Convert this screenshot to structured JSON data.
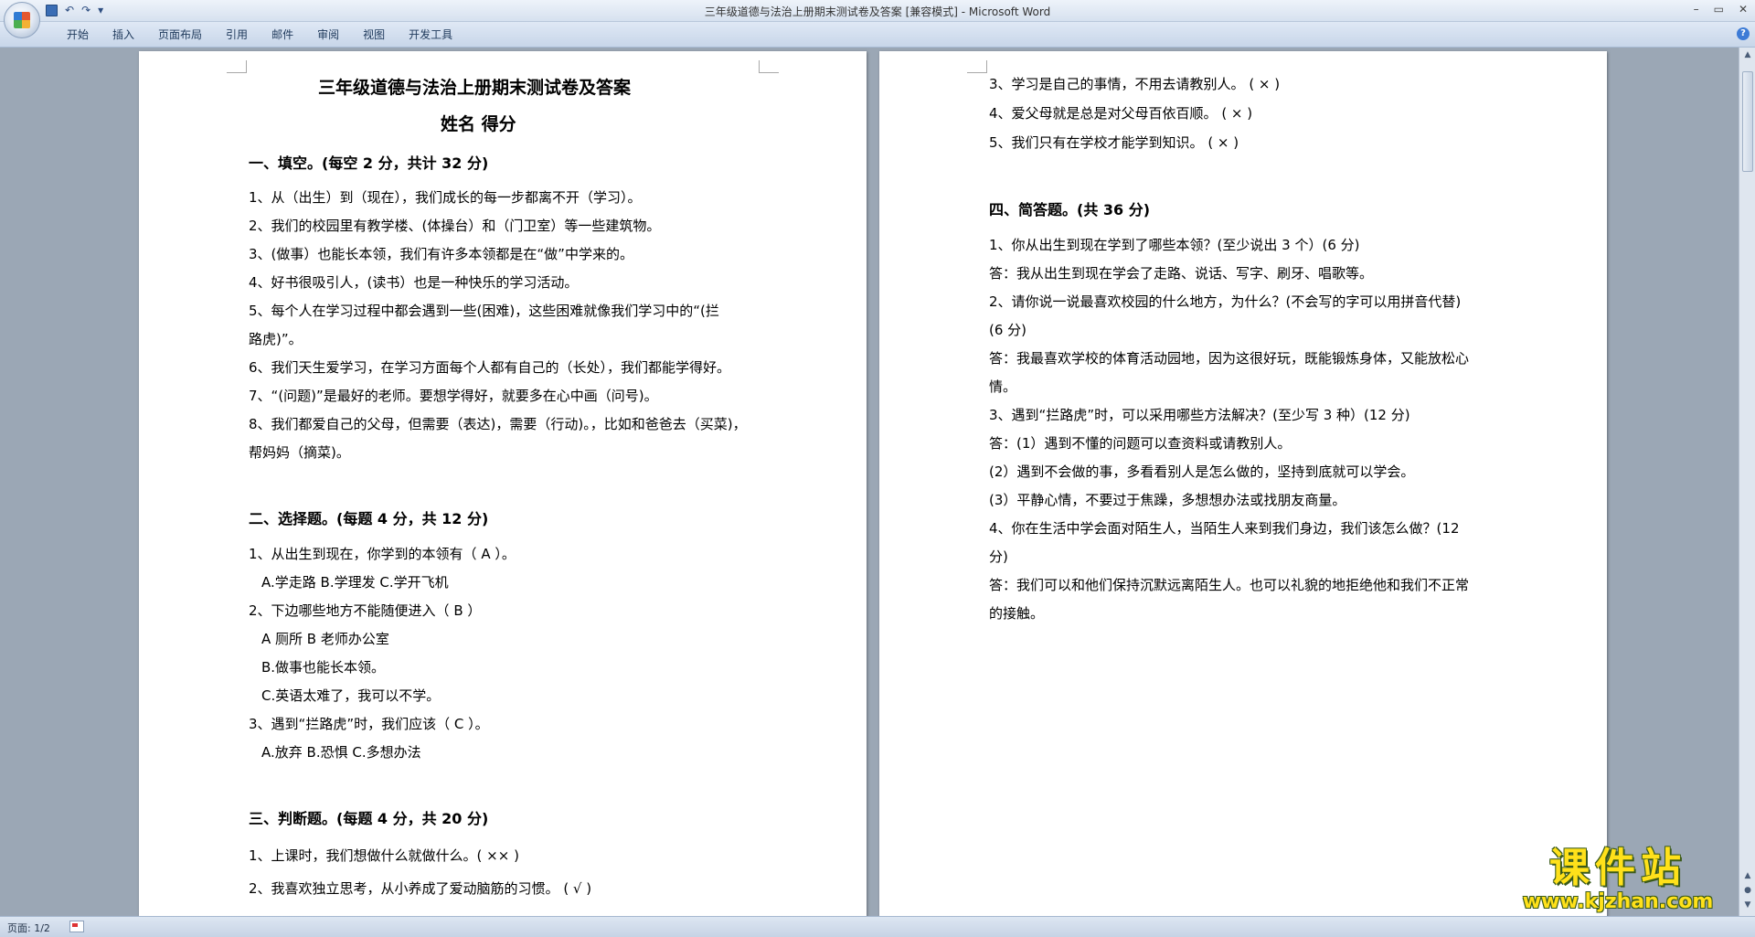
{
  "window": {
    "title": "三年级道德与法治上册期末测试卷及答案 [兼容模式] - Microsoft Word"
  },
  "qat": {
    "undo": "↶",
    "redo": "↷",
    "more": "▾"
  },
  "ribbon": {
    "tabs": [
      "开始",
      "插入",
      "页面布局",
      "引用",
      "邮件",
      "审阅",
      "视图",
      "开发工具"
    ],
    "help": "?"
  },
  "status": {
    "page": "页面: 1/2"
  },
  "watermark": {
    "line1": "课件站",
    "line2": "www.kjzhan.com"
  },
  "doc": {
    "page1": {
      "title": "三年级道德与法治上册期末测试卷及答案",
      "subtitle": "姓名        得分",
      "lines": [
        "一、填空。(每空 2 分，共计 32 分)",
        "1、从（出生）到（现在），我们成长的每一步都离不开（学习）。",
        "2、我们的校园里有教学楼、(体操台）和（门卫室）等一些建筑物。",
        "3、(做事）也能长本领，我们有许多本领都是在“做”中学来的。",
        "4、好书很吸引人，(读书）也是一种快乐的学习活动。",
        "5、每个人在学习过程中都会遇到一些(困难)，这些困难就像我们学习中的“(拦",
        "路虎)”。",
        "6、我们天生爱学习，在学习方面每个人都有自己的（长处），我们都能学得好。",
        "7、“(问题)”是最好的老师。要想学得好，就要多在心中画（问号)。",
        "8、我们都爱自己的父母，但需要（表达)，需要（行动)。，比如和爸爸去（买菜)，",
        "帮妈妈（摘菜)。",
        "",
        "二、选择题。(每题 4 分，共 12 分)",
        "1、从出生到现在，你学到的本领有（   A    ）。",
        "A.学走路              B.学理发            C.学开飞机",
        "2、下边哪些地方不能随便进入（   B              ）",
        "A 厕所              B 老师办公室",
        "B.做事也能长本领。",
        "C.英语太难了，我可以不学。",
        "3、遇到“拦路虎”时，我们应该（    C    ）。",
        "A.放弃                   B.恐惧                 C.多想办法",
        "",
        "三、判断题。(每题 4 分，共 20 分)",
        "1、上课时，我们想做什么就做什么。(       ××     )",
        "2、我喜欢独立思考，从小养成了爱动脑筋的习惯。        (    √     )"
      ]
    },
    "page2": {
      "lines": [
        "3、学习是自己的事情，不用去请教别人。                     (    ×    )",
        "4、爱父母就是总是对父母百依百顺。        (    ×     )",
        "5、我们只有在学校才能学到知识。                          (    ×    )",
        "",
        "四、简答题。(共 36 分)",
        "1、你从出生到现在学到了哪些本领？(至少说出 3 个）(6 分)",
        "答：我从出生到现在学会了走路、说话、写字、刷牙、唱歌等。",
        "2、请你说一说最喜欢校园的什么地方，为什么？(不会写的字可以用拼音代替)",
        "(6 分)",
        "答：我最喜欢学校的体育活动园地，因为这很好玩，既能锻炼身体，又能放松心",
        "情。",
        "3、遇到“拦路虎”时，可以采用哪些方法解决？(至少写 3 种）(12 分)",
        "答：(1）遇到不懂的问题可以查资料或请教别人。",
        "(2）遇到不会做的事，多看看别人是怎么做的，坚持到底就可以学会。",
        "(3）平静心情，不要过于焦躁，多想想办法或找朋友商量。",
        "4、你在生活中学会面对陌生人，当陌生人来到我们身边，我们该怎么做？(12",
        "分)",
        "答：我们可以和他们保持沉默远离陌生人。也可以礼貌的地拒绝他和我们不正常",
        "的接触。"
      ]
    }
  }
}
